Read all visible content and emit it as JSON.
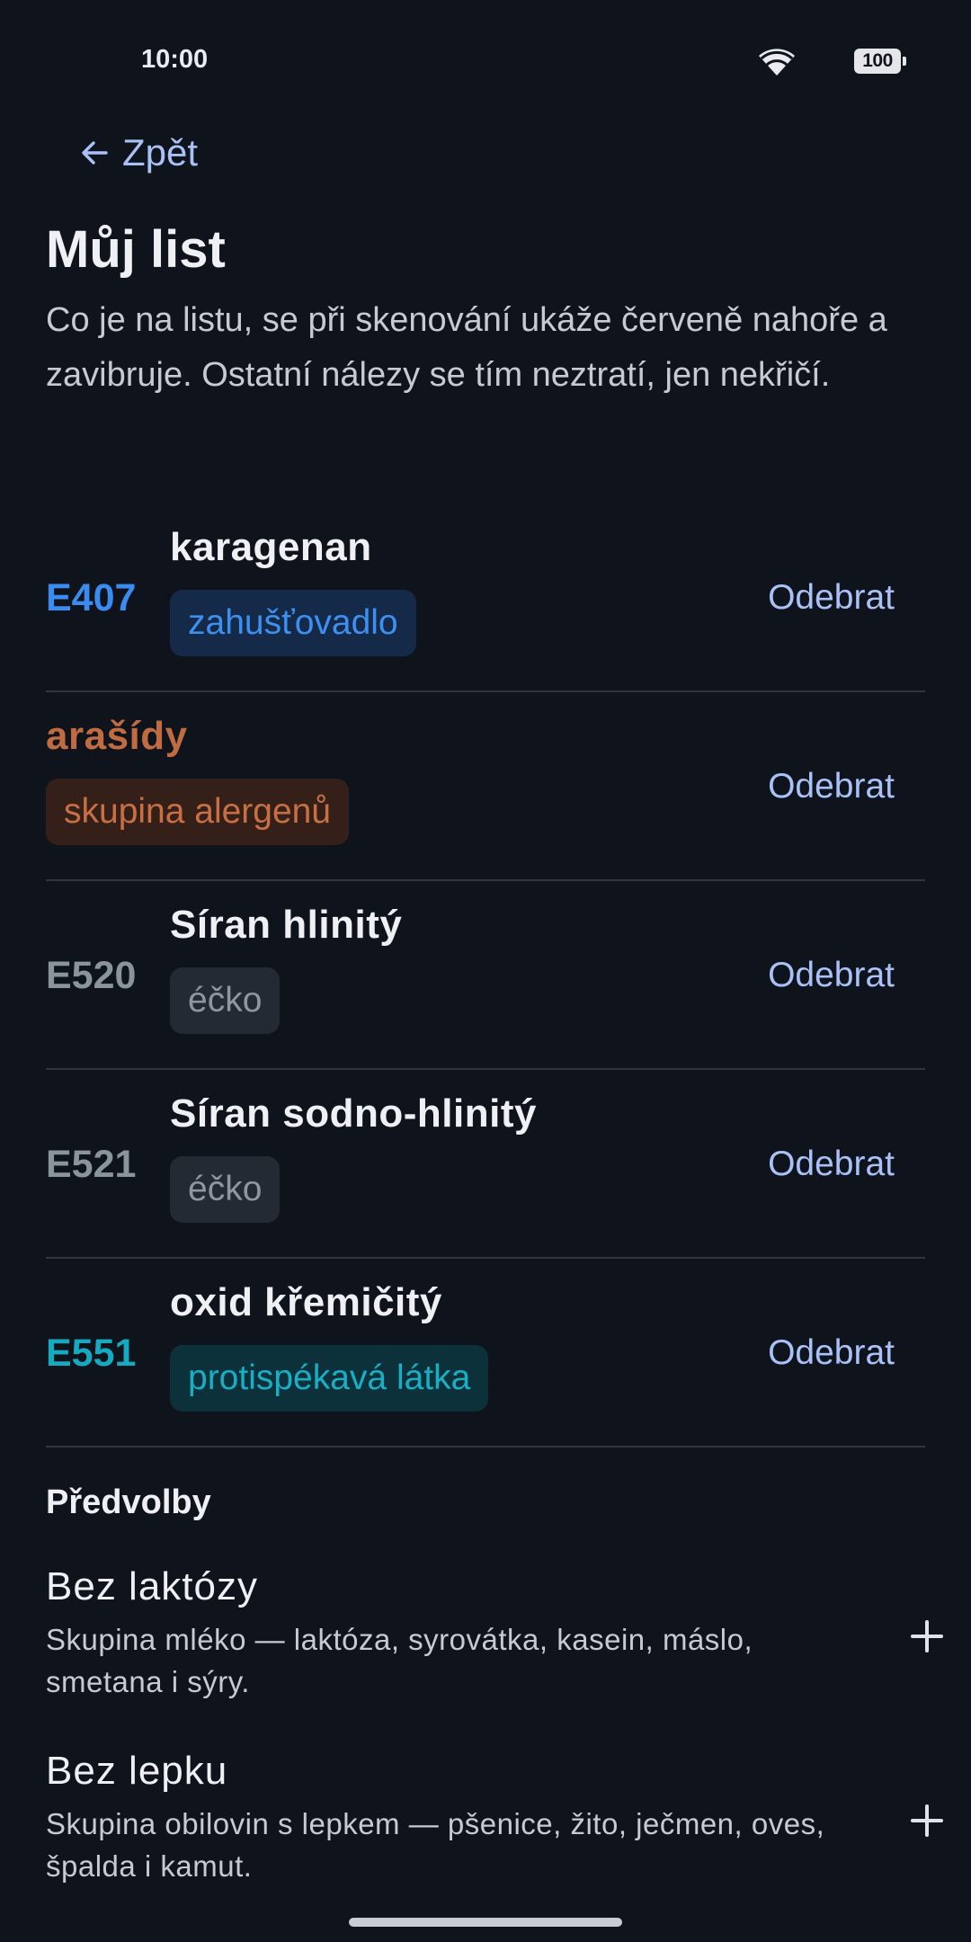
{
  "status_bar": {
    "time": "10:00",
    "battery": "100"
  },
  "nav": {
    "back_label": "Zpět"
  },
  "page": {
    "title": "Můj list",
    "description": "Co je na listu, se při skenování ukáže červeně nahoře a zavibruje. Ostatní nálezy se tím neztratí, jen nekřičí."
  },
  "list": {
    "remove_label": "Odebrat",
    "items": [
      {
        "code": "E407",
        "name": "karagenan",
        "category": "zahušťovadlo",
        "color": "#3a8cf0"
      },
      {
        "code": "",
        "name": "arašídy",
        "category": "skupina alergenů",
        "color": "#c06b40"
      },
      {
        "code": "E520",
        "name": "Síran hlinitý",
        "category": "éčko",
        "color": "#8a949c"
      },
      {
        "code": "E521",
        "name": "Síran sodno-hlinitý",
        "category": "éčko",
        "color": "#8a949c"
      },
      {
        "code": "E551",
        "name": "oxid křemičitý",
        "category": "protispékavá látka",
        "color": "#17a9c0"
      }
    ]
  },
  "presets": {
    "title": "Předvolby",
    "items": [
      {
        "name": "Bez laktózy",
        "description": "Skupina mléko — laktóza, syrovátka, kasein, máslo, smetana i sýry.",
        "action_icon": "plus-icon"
      },
      {
        "name": "Bez lepku",
        "description": "Skupina obilovin s lepkem — pšenice, žito, ječmen, oves, špalda i kamut.",
        "action_icon": "plus-icon"
      }
    ]
  }
}
